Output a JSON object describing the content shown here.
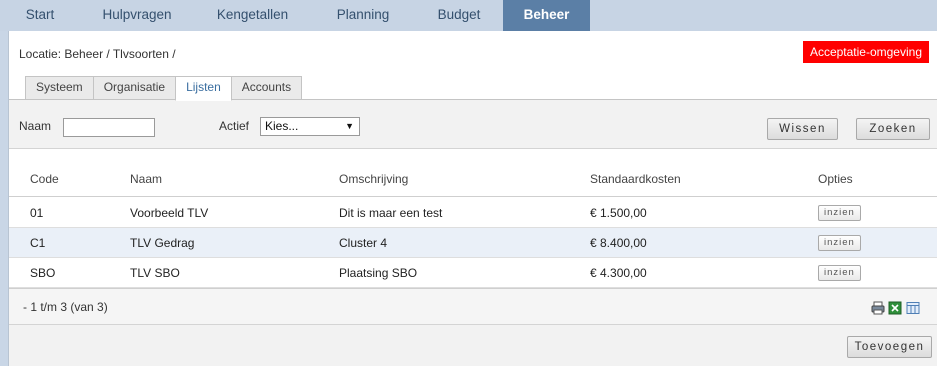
{
  "nav": {
    "items": [
      {
        "label": "Start"
      },
      {
        "label": "Hulpvragen"
      },
      {
        "label": "Kengetallen"
      },
      {
        "label": "Planning"
      },
      {
        "label": "Budget"
      },
      {
        "label": "Beheer",
        "active": true
      }
    ]
  },
  "location": {
    "prefix": "Locatie:",
    "path": "Beheer / Tlvsoorten /"
  },
  "environment_badge": "Acceptatie-omgeving",
  "tabs": [
    {
      "label": "Systeem"
    },
    {
      "label": "Organisatie"
    },
    {
      "label": "Lijsten",
      "active": true
    },
    {
      "label": "Accounts"
    }
  ],
  "filter": {
    "name_label": "Naam",
    "name_value": "",
    "active_label": "Actief",
    "active_selected": "Kies...",
    "clear_button": "Wissen",
    "search_button": "Zoeken"
  },
  "table": {
    "columns": [
      "Code",
      "Naam",
      "Omschrijving",
      "Standaardkosten",
      "Opties"
    ],
    "rows": [
      {
        "code": "01",
        "name": "Voorbeeld TLV",
        "description": "Dit is maar een test",
        "cost": "€ 1.500,00",
        "option": "inzien"
      },
      {
        "code": "C1",
        "name": "TLV Gedrag",
        "description": "Cluster 4",
        "cost": "€ 8.400,00",
        "option": "inzien"
      },
      {
        "code": "SBO",
        "name": "TLV SBO",
        "description": "Plaatsing SBO",
        "cost": "€ 4.300,00",
        "option": "inzien"
      }
    ]
  },
  "pager": "- 1 t/m 3 (van 3)",
  "footer_icons": [
    "print-icon",
    "excel-export-icon",
    "column-settings-icon"
  ],
  "add_button": "Toevoegen",
  "colors": {
    "nav_bg": "#c7d4e4",
    "nav_active": "#5b7fa6",
    "badge_red": "#ff0000",
    "row_alt": "#eaf0f8"
  }
}
